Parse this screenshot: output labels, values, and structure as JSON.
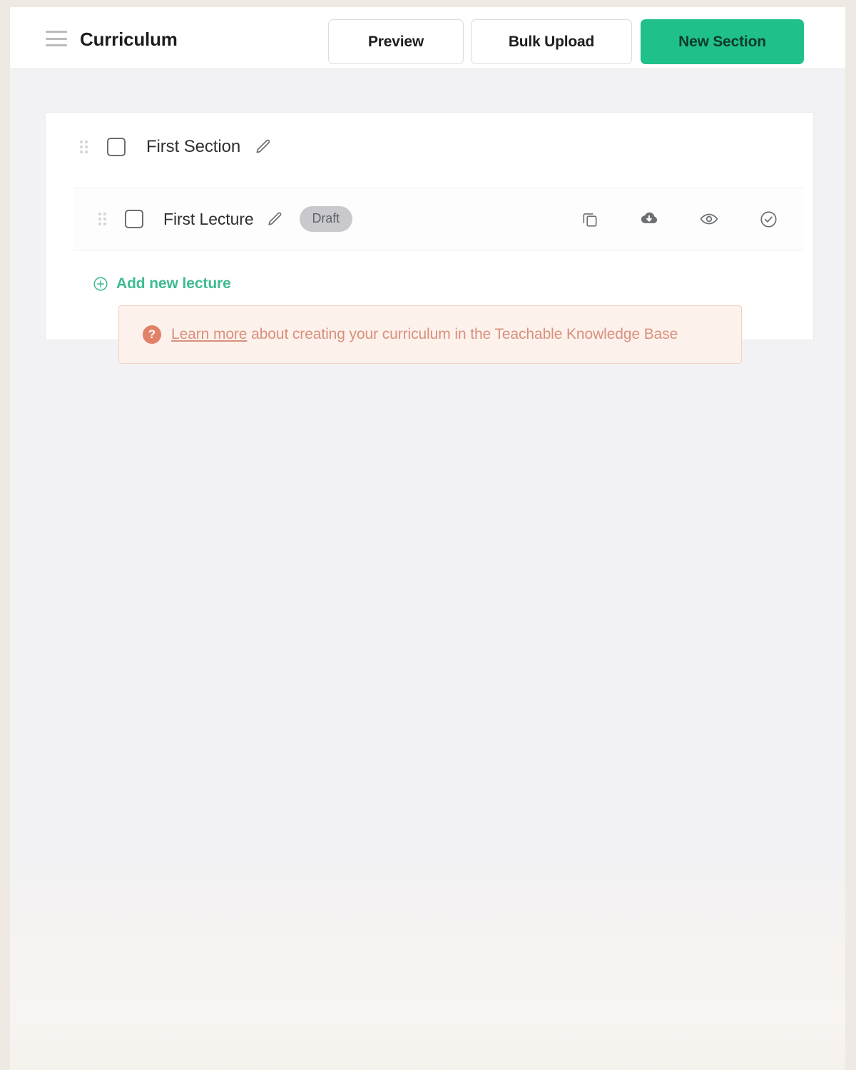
{
  "header": {
    "menu_icon": "hamburger-menu-icon",
    "title": "Curriculum",
    "buttons": [
      {
        "label": "Preview",
        "style": "outline"
      },
      {
        "label": "Bulk Upload",
        "style": "outline"
      },
      {
        "label": "New Section",
        "style": "primary"
      }
    ]
  },
  "curriculum": {
    "section": {
      "drag_handle_icon": "drag-handle-icon",
      "checkbox_checked": false,
      "title": "First Section",
      "edit_icon": "pencil-icon"
    },
    "lecture": {
      "drag_handle_icon": "drag-handle-icon",
      "checkbox_checked": false,
      "title": "First Lecture",
      "edit_icon": "pencil-icon",
      "status_badge": "Draft",
      "actions": [
        {
          "name": "duplicate-lecture",
          "icon": "copy-icon"
        },
        {
          "name": "download-lecture",
          "icon": "cloud-download-icon"
        },
        {
          "name": "preview-lecture",
          "icon": "eye-icon"
        },
        {
          "name": "publish-lecture",
          "icon": "check-circle-icon"
        }
      ]
    },
    "add_lecture": {
      "icon": "plus-circle-icon",
      "label": "Add new lecture"
    }
  },
  "info_banner": {
    "icon": "question-circle-icon",
    "link_text": "Learn more",
    "text": " about creating your curriculum in the Teachable Knowledge Base"
  },
  "colors": {
    "accent_teal": "#1fc08a",
    "link_teal": "#3ebb92",
    "banner_bg": "#fdf1ec",
    "banner_border": "#f5cfc2",
    "banner_text": "#d9907c",
    "banner_icon": "#e08168",
    "badge_bg": "#c9c9cd",
    "page_bg": "#f2f2f4",
    "frame_bg": "#efe9e3",
    "icon_gray": "#6a6f73"
  }
}
